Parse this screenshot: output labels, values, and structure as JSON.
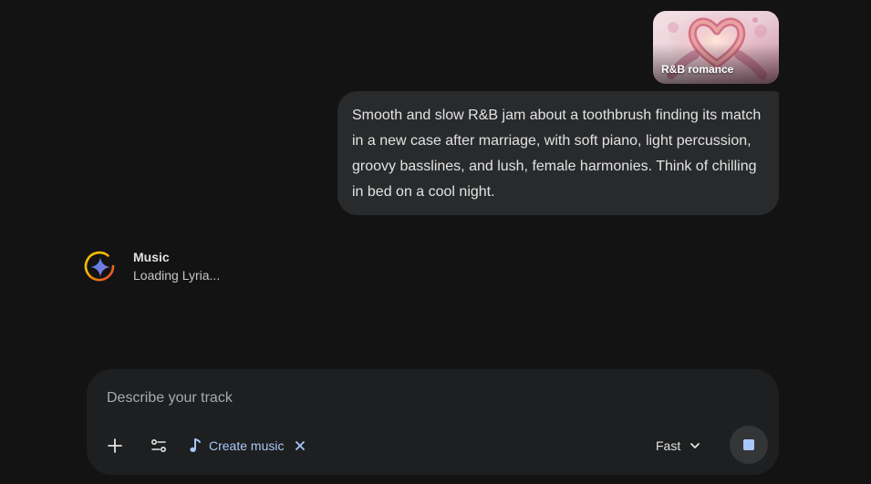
{
  "attachment": {
    "label": "R&B romance",
    "icon": "heart-hands-image"
  },
  "user_message": {
    "text": "Smooth and slow R&B jam about a toothbrush finding its match in a new case after marriage, with soft piano, light percussion, groovy basslines, and lush, female harmonies. Think of chilling in bed on a cool night."
  },
  "response": {
    "icon": "gemini-spark-icon",
    "title": "Music",
    "status": "Loading Lyria..."
  },
  "composer": {
    "placeholder": "Describe your track",
    "value": "",
    "add_icon": "plus-icon",
    "tools_icon": "tools-sliders-icon",
    "chip": {
      "icon": "music-note-icon",
      "label": "Create music",
      "close_icon": "close-icon"
    },
    "mode": {
      "label": "Fast",
      "icon": "chevron-down-icon"
    },
    "stop_icon": "stop-icon"
  },
  "colors": {
    "background": "#131314",
    "bubble": "#282a2c",
    "composer": "#1e1f20",
    "accent": "#a8c7fa",
    "text": "#e3e3e3",
    "muted_text": "#c4c7c5"
  }
}
